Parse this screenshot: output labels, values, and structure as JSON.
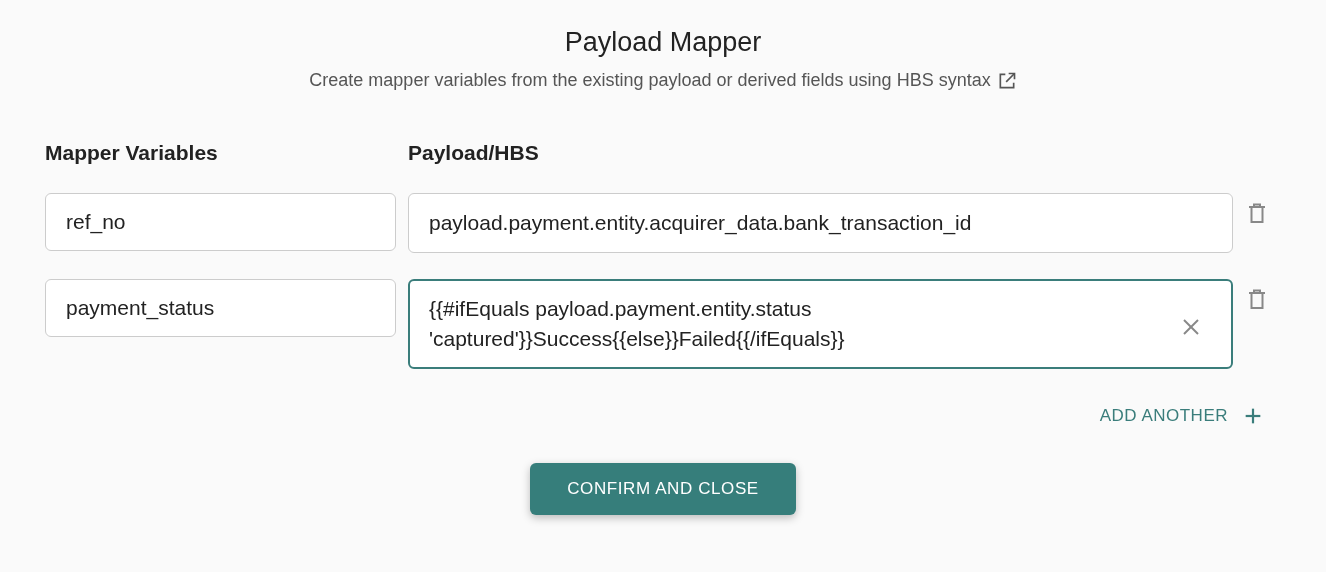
{
  "dialog": {
    "title": "Payload Mapper",
    "subtitle": "Create mapper variables from the existing payload or derived fields using HBS syntax"
  },
  "columns": [
    "Mapper Variables",
    "Payload/HBS"
  ],
  "rows": [
    {
      "variable": "ref_no",
      "expression": "payload.payment.entity.acquirer_data.bank_transaction_id",
      "focused": false
    },
    {
      "variable": "payment_status",
      "expression": "{{#ifEquals payload.payment.entity.status 'captured'}}Success{{else}}Failed{{/ifEquals}}",
      "focused": true
    }
  ],
  "add_button": "ADD ANOTHER",
  "confirm_button": "CONFIRM AND CLOSE"
}
